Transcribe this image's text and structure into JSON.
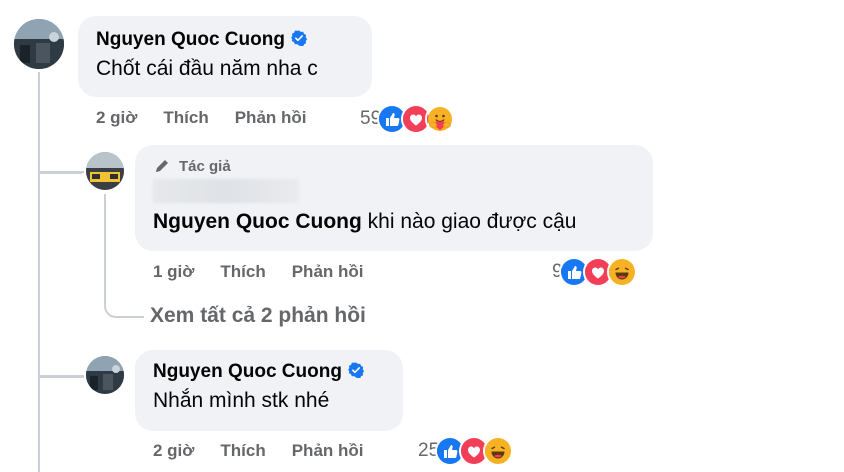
{
  "comments": [
    {
      "name": "Nguyen Quoc Cuong",
      "verified": true,
      "text": "Chốt cái đầu năm nha c",
      "time": "2 giờ",
      "like_label": "Thích",
      "reply_label": "Phản hồi",
      "reaction_count": "59",
      "reactions": [
        "like-icon",
        "love-icon",
        "care-icon"
      ]
    }
  ],
  "replies": [
    {
      "author_badge": "Tác giả",
      "name": "Nguyen Quoc Cuong",
      "text": "khi nào giao được cậu",
      "time": "1 giờ",
      "like_label": "Thích",
      "reply_label": "Phản hồi",
      "reaction_count": "9",
      "reactions": [
        "like-icon",
        "love-icon",
        "haha-icon"
      ]
    },
    {
      "name": "Nguyen Quoc Cuong",
      "verified": true,
      "text": "Nhắn mình stk nhé",
      "time": "2 giờ",
      "like_label": "Thích",
      "reply_label": "Phản hồi",
      "reaction_count": "25",
      "reactions": [
        "like-icon",
        "love-icon",
        "haha-icon"
      ]
    }
  ],
  "view_more": "Xem tất cả 2 phản hồi",
  "colors": {
    "bubble": "#f0f2f5",
    "meta": "#65676b",
    "like": "#1877f2",
    "love": "#f33e58",
    "haha": "#f7b125",
    "verified": "#1877f2"
  }
}
